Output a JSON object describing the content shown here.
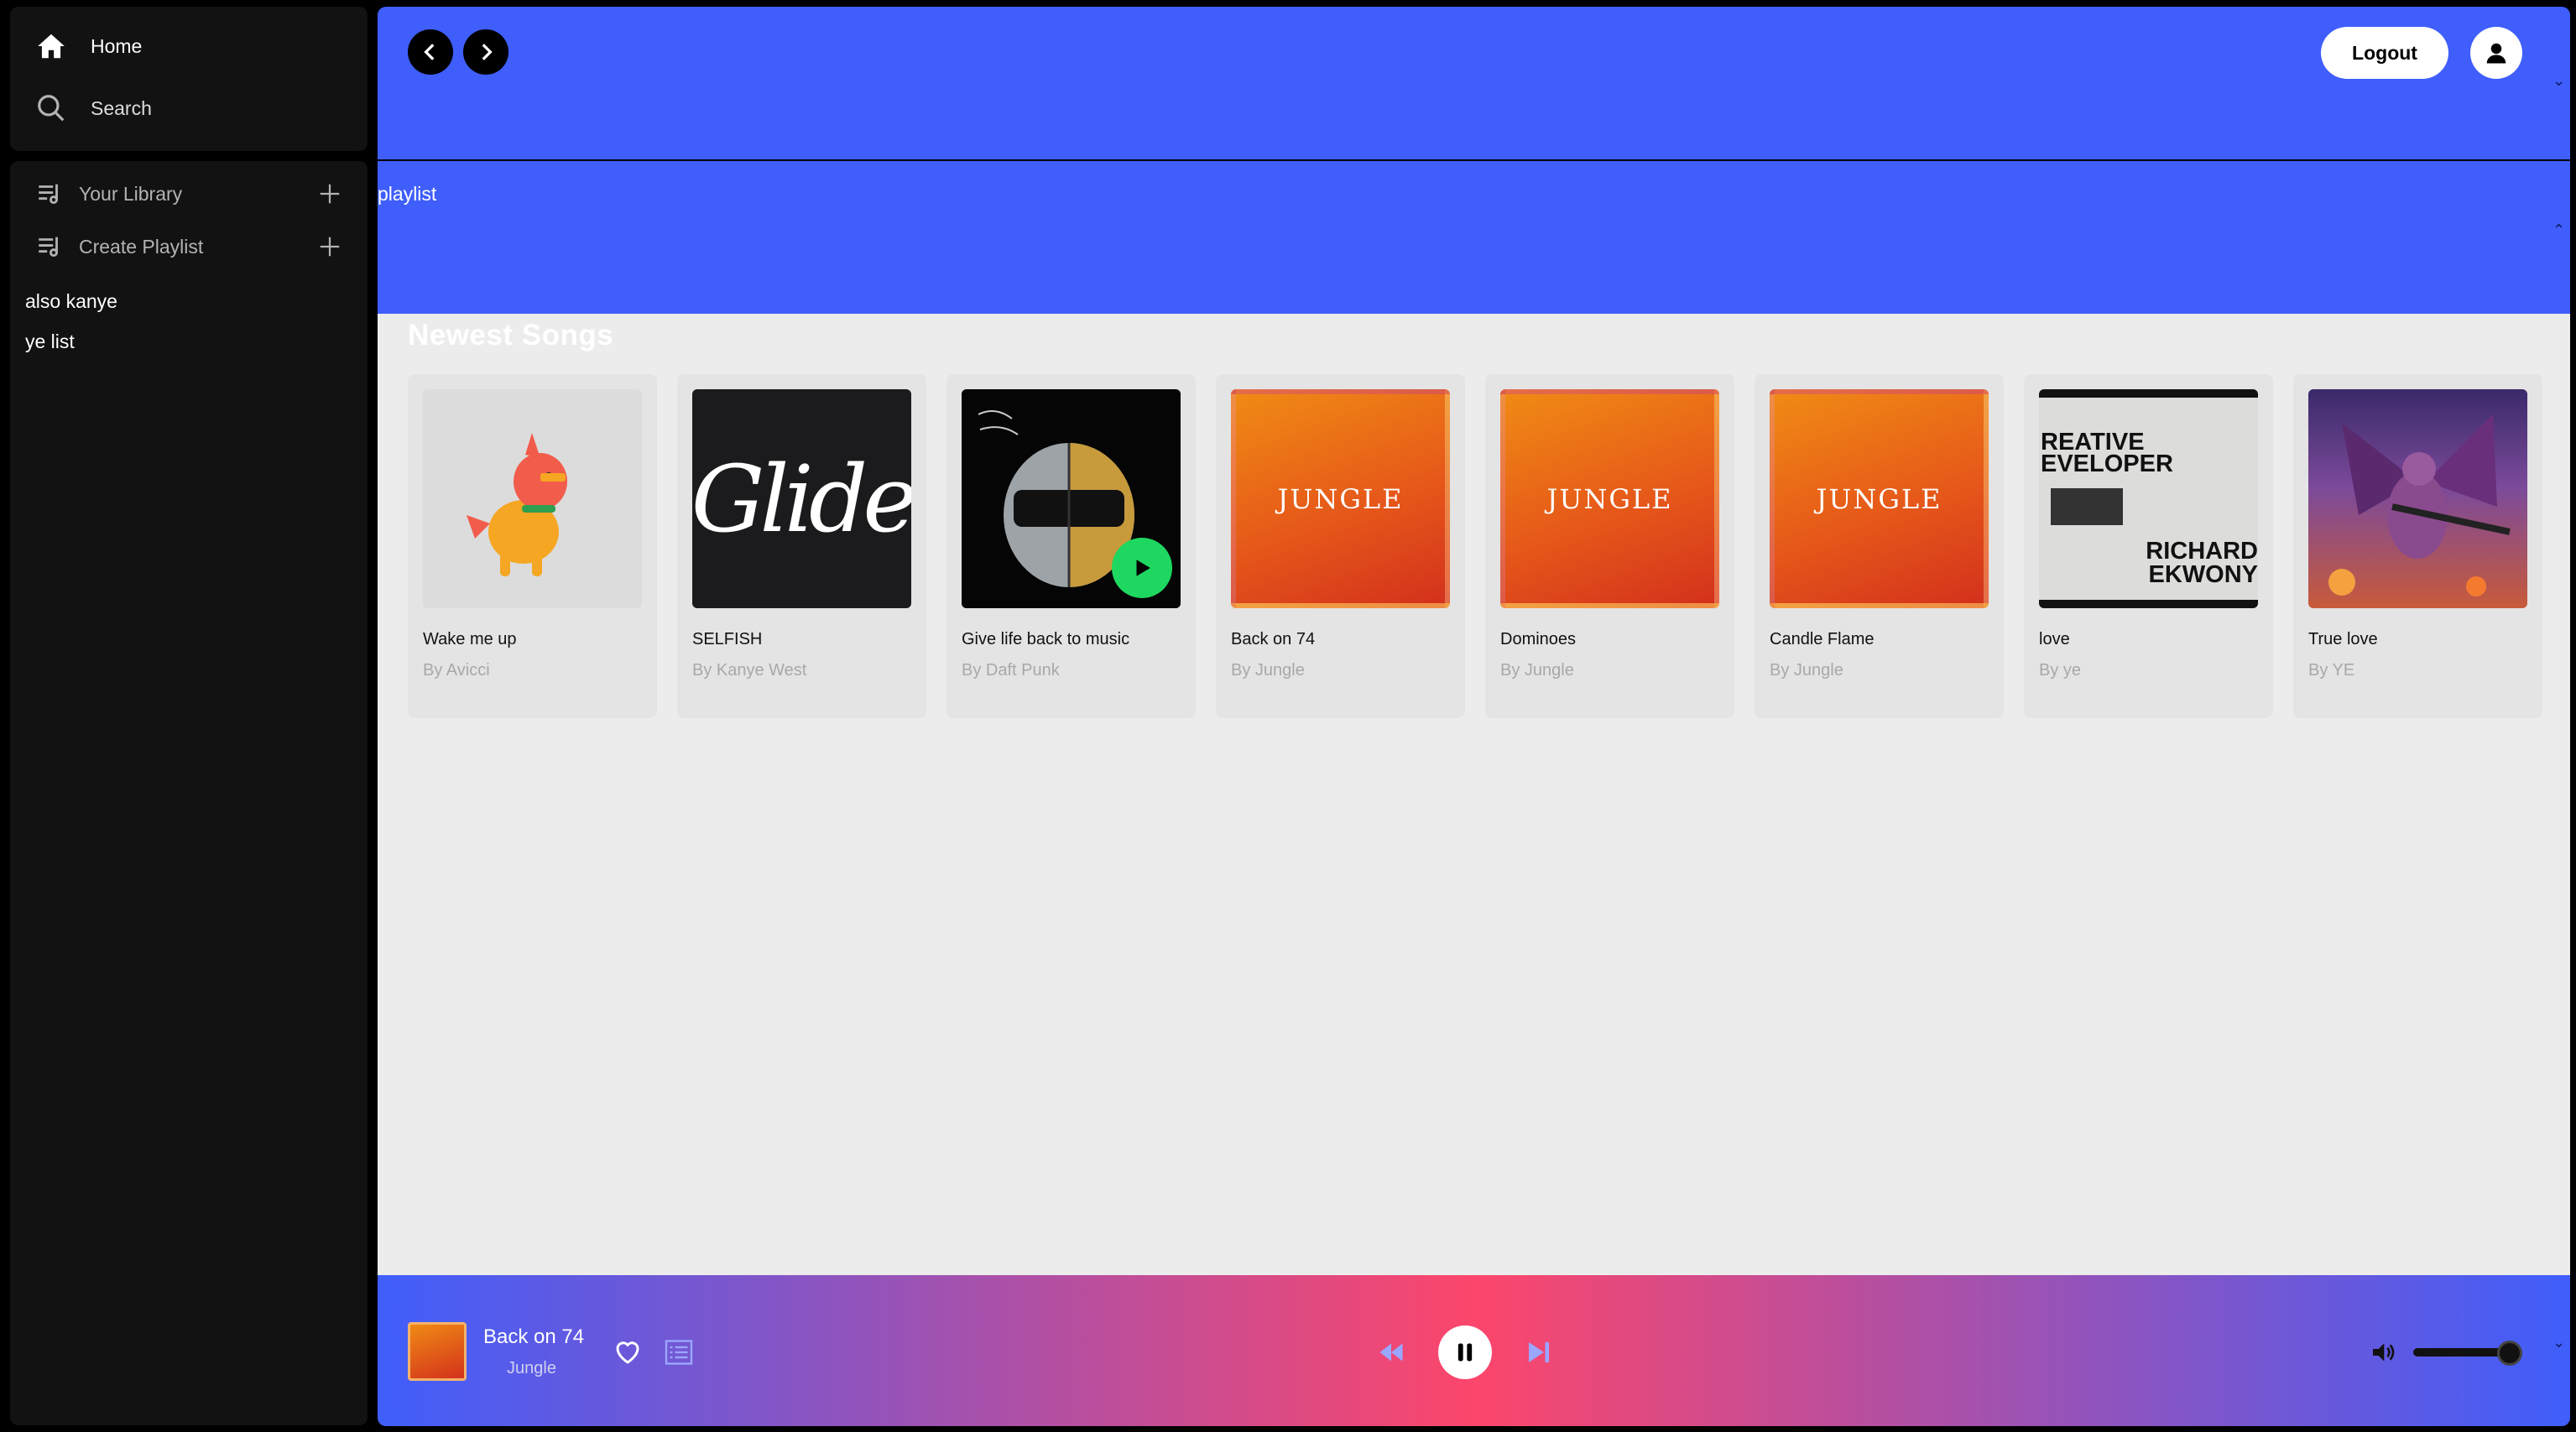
{
  "sidebar": {
    "nav": [
      {
        "label": "Home",
        "icon": "home-icon"
      },
      {
        "label": "Search",
        "icon": "search-icon"
      }
    ],
    "library_label": "Your Library",
    "create_playlist_label": "Create Playlist",
    "playlists": [
      "also kanye",
      "ye list"
    ]
  },
  "header": {
    "logout_label": "Logout"
  },
  "band": {
    "label": "playlist"
  },
  "main": {
    "section_title": "Newest Songs",
    "songs": [
      {
        "title": "Wake me up",
        "artist": "By Avicci"
      },
      {
        "title": "SELFISH",
        "artist": "By Kanye West",
        "cover_text": "Glide"
      },
      {
        "title": "Give life back to music",
        "artist": "By Daft Punk"
      },
      {
        "title": "Back on 74",
        "artist": "By Jungle",
        "cover_text": "JUNGLE"
      },
      {
        "title": "Dominoes",
        "artist": "By Jungle",
        "cover_text": "JUNGLE"
      },
      {
        "title": "Candle Flame",
        "artist": "By Jungle",
        "cover_text": "JUNGLE"
      },
      {
        "title": "love",
        "artist": "By ye",
        "cover_lines": [
          "REATIVE",
          "EVELOPER",
          "RICHARD",
          "EKWONY"
        ]
      },
      {
        "title": "True love",
        "artist": "By YE"
      }
    ]
  },
  "player": {
    "title": "Back on 74",
    "artist": "Jungle",
    "volume": 0.9
  },
  "colors": {
    "accent_blue": "#3f5efb",
    "accent_pink": "#fc466b",
    "play_green": "#1ed760"
  }
}
